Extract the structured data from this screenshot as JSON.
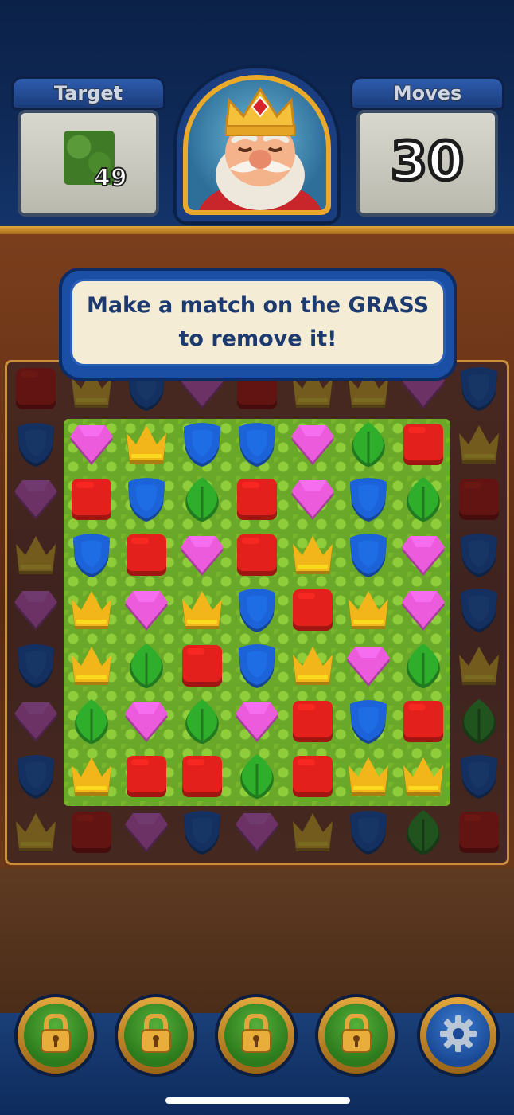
{
  "header": {
    "target_label": "Target",
    "target_count": "49",
    "target_item": "grass",
    "moves_label": "Moves",
    "moves_count": "30",
    "portrait": "king-portrait"
  },
  "tooltip": {
    "line1": "Make a match on the GRASS",
    "line2": "to remove it!"
  },
  "board": {
    "rows": [
      [
        "cube",
        "crown",
        "shield",
        "gem",
        "cube",
        "crown",
        "crown",
        "gem",
        "shield"
      ],
      [
        "shield",
        "gem",
        "crown",
        "shield",
        "shield",
        "gem",
        "leaf",
        "cube",
        "crown"
      ],
      [
        "gem",
        "cube",
        "shield",
        "leaf",
        "cube",
        "gem",
        "shield",
        "leaf",
        "cube"
      ],
      [
        "crown",
        "shield",
        "cube",
        "gem",
        "cube",
        "crown",
        "shield",
        "gem",
        "shield"
      ],
      [
        "gem",
        "crown",
        "gem",
        "crown",
        "shield",
        "cube",
        "crown",
        "gem",
        "shield"
      ],
      [
        "shield",
        "crown",
        "leaf",
        "cube",
        "shield",
        "crown",
        "gem",
        "leaf",
        "crown"
      ],
      [
        "gem",
        "leaf",
        "gem",
        "leaf",
        "gem",
        "cube",
        "shield",
        "cube",
        "leaf"
      ],
      [
        "shield",
        "crown",
        "cube",
        "cube",
        "leaf",
        "cube",
        "crown",
        "crown",
        "shield"
      ],
      [
        "crown",
        "cube",
        "gem",
        "shield",
        "gem",
        "crown",
        "shield",
        "leaf",
        "cube"
      ]
    ],
    "grass_region": {
      "first_row": 1,
      "last_row": 7,
      "first_col": 1,
      "last_col": 7
    }
  },
  "colors": {
    "cube": "#e3201b",
    "crown": "#f2b51a",
    "shield": "#1c62d8",
    "gem": "#ec5bdc",
    "leaf": "#2fae2c"
  },
  "toolbar": {
    "buttons": [
      {
        "name": "booster-slot-1",
        "icon": "lock-icon"
      },
      {
        "name": "booster-slot-2",
        "icon": "lock-icon"
      },
      {
        "name": "booster-slot-3",
        "icon": "lock-icon"
      },
      {
        "name": "booster-slot-4",
        "icon": "lock-icon"
      },
      {
        "name": "settings-button",
        "icon": "gear-icon"
      }
    ]
  }
}
